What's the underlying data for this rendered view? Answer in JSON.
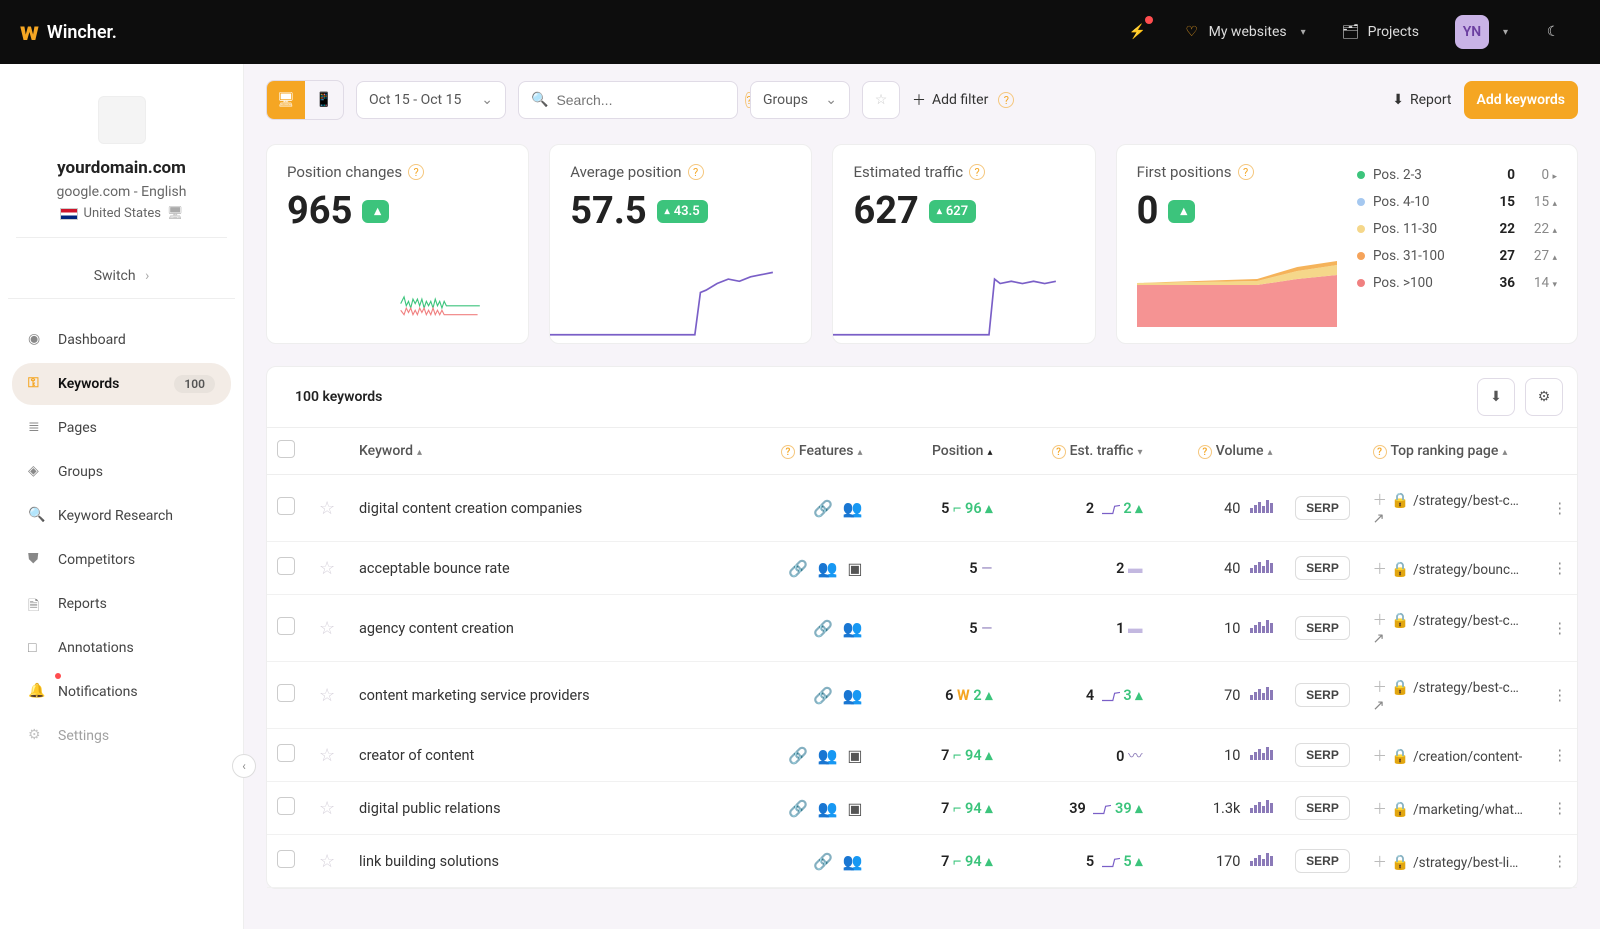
{
  "brand": "Wincher.",
  "top": {
    "my_websites": "My websites",
    "projects": "Projects",
    "avatar": "YN"
  },
  "site": {
    "name": "yourdomain.com",
    "engine": "google.com - English",
    "country": "United States",
    "switch": "Switch"
  },
  "nav": {
    "dashboard": "Dashboard",
    "keywords": "Keywords",
    "keywords_count": "100",
    "pages": "Pages",
    "groups": "Groups",
    "research": "Keyword Research",
    "competitors": "Competitors",
    "reports": "Reports",
    "annotations": "Annotations",
    "notifications": "Notifications",
    "settings": "Settings"
  },
  "toolbar": {
    "daterange": "Oct 15 - Oct 15",
    "search_ph": "Search...",
    "groups": "Groups",
    "add_filter": "Add filter",
    "report": "Report",
    "add_keywords": "Add keywords"
  },
  "cards": {
    "pos_changes": {
      "title": "Position changes",
      "value": "965"
    },
    "avg_pos": {
      "title": "Average position",
      "value": "57.5",
      "delta": "43.5"
    },
    "est_traffic": {
      "title": "Estimated traffic",
      "value": "627",
      "delta": "627"
    },
    "first_pos": {
      "title": "First positions",
      "value": "0"
    }
  },
  "pos_ranges": [
    {
      "label": "Pos. 2-3",
      "v1": "0",
      "v2": "0",
      "arrow": "▸",
      "color": "#3cc47c"
    },
    {
      "label": "Pos. 4-10",
      "v1": "15",
      "v2": "15",
      "arrow": "▴",
      "color": "#a5c8f0"
    },
    {
      "label": "Pos. 11-30",
      "v1": "22",
      "v2": "22",
      "arrow": "▴",
      "color": "#f5d78a"
    },
    {
      "label": "Pos. 31-100",
      "v1": "27",
      "v2": "27",
      "arrow": "▴",
      "color": "#f5a35a"
    },
    {
      "label": "Pos. >100",
      "v1": "36",
      "v2": "14",
      "arrow": "▾",
      "color": "#f08080"
    }
  ],
  "table": {
    "tab": "100 keywords",
    "cols": {
      "keyword": "Keyword",
      "features": "Features",
      "position": "Position",
      "est_traffic": "Est. traffic",
      "volume": "Volume",
      "top_page": "Top ranking page"
    },
    "serp_label": "SERP",
    "rows": [
      {
        "kw": "digital content creation companies",
        "link_on": true,
        "people_on": true,
        "ext": false,
        "pos": "5",
        "pos_delta": "96",
        "est": "2",
        "est_delta": "2",
        "vol": "40",
        "page": "/strategy/best-con",
        "ext_icon": true
      },
      {
        "kw": "acceptable bounce rate",
        "link_on": true,
        "people_on": true,
        "ext": true,
        "pos": "5",
        "pos_delta": "",
        "est": "2",
        "est_delta": "",
        "vol": "40",
        "page": "/strategy/bounce-r"
      },
      {
        "kw": "agency content creation",
        "link_on": true,
        "people_on": true,
        "ext": false,
        "pos": "5",
        "pos_delta": "",
        "est": "1",
        "est_delta": "",
        "vol": "10",
        "page": "/strategy/best-con",
        "ext_icon": true
      },
      {
        "kw": "content marketing service providers",
        "link_on": false,
        "people_on": true,
        "ext": false,
        "pos": "6",
        "pos_w": true,
        "pos_delta": "2",
        "est": "4",
        "est_delta": "3",
        "vol": "70",
        "page": "/strategy/best-con agencies",
        "ext_icon": true
      },
      {
        "kw": "creator of content",
        "link_on": true,
        "people_on": true,
        "ext": true,
        "pos": "7",
        "pos_delta": "94",
        "est": "0",
        "est_wave": true,
        "vol": "10",
        "page": "/creation/content-"
      },
      {
        "kw": "digital public relations",
        "link_on": true,
        "people_on": true,
        "ext": true,
        "pos": "7",
        "pos_delta": "94",
        "est": "39",
        "est_delta": "39",
        "vol": "1.3k",
        "page": "/marketing/what-is"
      },
      {
        "kw": "link building solutions",
        "link_on": true,
        "people_on": false,
        "ext": false,
        "pos": "7",
        "pos_delta": "94",
        "est": "5",
        "est_delta": "5",
        "vol": "170",
        "page": "/strategy/best-link"
      }
    ]
  },
  "chart_data": [
    {
      "type": "line",
      "title": "Position changes sparkline",
      "series": [
        {
          "name": "up",
          "color": "#3cc47c"
        },
        {
          "name": "down",
          "color": "#f08080"
        }
      ]
    },
    {
      "type": "line",
      "title": "Average position sparkline",
      "ylim": [
        0,
        100
      ],
      "color": "#7a5fc7"
    },
    {
      "type": "line",
      "title": "Estimated traffic sparkline",
      "ylim": [
        0,
        700
      ],
      "color": "#7a5fc7"
    },
    {
      "type": "area",
      "title": "First positions stacked",
      "series": [
        {
          "name": "Pos. 31-100",
          "color": "#f5a35a"
        },
        {
          "name": "Pos. 11-30",
          "color": "#f5d78a"
        },
        {
          "name": "Pos. 4-10",
          "color": "#a5c8f0"
        }
      ]
    }
  ]
}
